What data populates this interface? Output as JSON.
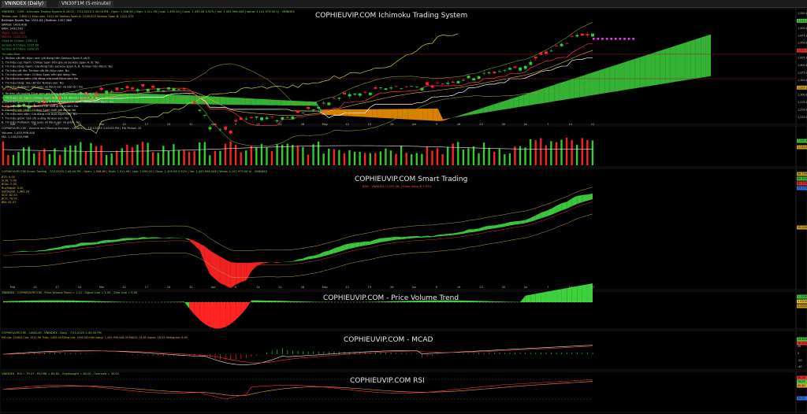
{
  "tabs": [
    {
      "label": "VNINDEX (Daily)",
      "active": true
    },
    {
      "label": "VN30F1M (5-minute)",
      "active": false
    }
  ],
  "watermarks": {
    "price": "COPHIEUVIP.COM Ichimoku Trading System",
    "smart": "COPHIEUVIP.COM Smart Trading",
    "pvt": "COPHIEUVIP.COM - Price Volume Trend",
    "macd": "COPHIEUVIP.COM - MCAD",
    "rsi": "COPHIEUVIP.COM RSI"
  },
  "panel_headers": {
    "price": "VNINDEX - COM - Ichimoku Trading System 6.26.02 - 7/21/2025 2:45:00 PM - Open: 1,508.60 | High: 1,511.96 | Low: 1,495.00 | Close: 1,495.06 0.92% | Vol: 1,455,996,448 | Value: 2,152,979.00 tỷ - VNINDEX",
    "volume": "COPHIEUVIP.COM - Volume and Moving Average - VNINDEX - 7/21/2025 2:45:00 PM | MA Period: 20",
    "smart": "COPHIEUVIP.COM Smart Trading - 7/21/2025 2:45:00 PM - Open: 1,508.60 | High: 1,511.96 | Low: 1,495.00 | Close: 1,495.06 0.92% | Vol: 1,455,996,448 | Value: 2,152,979.00 tỷ - VNINDEX",
    "pvt": "VNINDEX - COPHIEUVIP.COM - Price Volume Trend = 1.12 - Signal Line = 1.05 - Zero Line = 0.00",
    "macd": "COPHIEUVIP.COM - CANSLIM - VNINDEX - Daily - 7/21/2025 2:45:00 PM",
    "rsi": "VNINDEX - RSI = 79.07 - RSI MA = 65.80 - Overbought = 80.00 - Oversold = 30.00"
  },
  "price_info_lines": [
    "Tenkan-sen: 1466.11   Kijun-sen: 1412.00   Senkou Span A: 1239.525   Senkou Span B: 1212.275",
    "Bollinger Bands Top: 1531.63 | Bottom: 1327.288",
    "SMA20: 1420.428",
    "EMA: 1491.592",
    "MA50: 1402.988",
    "MA200: 1283.124",
    "Close At Chikou: 1330.11",
    "Senkou A Chikou: 1235.60",
    "Senkou B Chikou: 1208.35"
  ],
  "signal_lines_bull": [
    "Tín hiệu Mua",
    "1. Tenkan cắt lên Kijun sen: giá đang trên Senkou Span A và B",
    "2. Tín hiệu cực mạnh: Chikou Span trên giá và Senkou Span A, B: Yes",
    "3. Tín hiệu tăng mạnh: Giá đóng trên Senkou Span A, B. Tenkan trên Kijun: Yes",
    "4. Tín hiệu cắt lên: Tenkan cắt lên Kijun-sen: No",
    "5. Tín hiệu xác nhận: Chikou Span trên giá đóng: Yes",
    "6. Tín hiệu mua sớm: Giá đóng cửa vượt Kijun-sen: No",
    "7. Tín hiệu tăng: Giá cắt lên Tenkan-sen: No",
    "8. Tín hiệu Pullback: Giá quay về Kijun-sen và bật lên: No"
  ],
  "signal_lines_bear": [
    "Tín hiệu Bán",
    "1. Tenkan cắt xuống Kijun sen: giá đang dưới Senkou Span A và B",
    "2. Tín hiệu cực mạnh: Chikou Span dưới giá và Senkou Span A, B: No",
    "3. Tín hiệu giảm mạnh: Giá đóng dưới Senkou Span A, B. Tenkan dưới Kijun: No",
    "4. Tín hiệu cắt xuống: Tenkan cắt xuống Kijun-sen: No",
    "5. Tín hiệu xác nhận: Chikou Span dưới giá đóng: No",
    "6. Tín hiệu bán sớm: Giá đóng cửa dưới Kijun-sen: No",
    "7. Tín hiệu giảm: Giá cắt xuống Tenkan-sen: No",
    "8. Tín hiệu Pullback: Giá quay về Kijun-sen và giảm: No"
  ],
  "smart_info_lines": [
    "BTS: 0.00",
    "SCAL: 0.00",
    "BCAL: 0.00",
    "BuySignal: 0.00",
    "SellSignal: 1,463.26",
    "SCO: 82.53",
    "BCO: 79.07",
    "BIN: 81.07"
  ],
  "smart_center_note": "BÁN - VNINDEX (1,495.06) | Điểm dừng lỗ 0.92%",
  "volume_info": [
    "Volume: 1,455,996,448",
    "MA: 1,144,035,966"
  ],
  "macd_info": "Mở cửa: 1508.6   Cao: 1511.96   Thấp: 1495.00   Đóng cửa: 1495.06   Khối lượng: 1,455,996,448.00   MACD: 24.65   Signal: 18.05   Histogram: 6.60",
  "x_axis_labels": [
    "Feb",
    "10",
    "17",
    "24",
    "Mar",
    "10",
    "17",
    "24",
    "31",
    "Apr",
    "9",
    "14",
    "21",
    "28",
    "May",
    "12",
    "19",
    "26",
    "Jun",
    "9",
    "16",
    "23",
    "30",
    "Jul",
    "7",
    "14",
    "21"
  ],
  "price_axis_labels": [
    "1,550.00",
    "1,512.34",
    "1,500.00",
    "1,475.00",
    "1,450.00",
    "1,431.58",
    "1,425.00",
    "1,400.00",
    "1,375.00",
    "1,350.00",
    "1,327.27",
    "1,300.00",
    "1,275.00",
    "1,250.00",
    "1,225.00"
  ],
  "volume_axis_labels": [
    "1,455,996,448",
    "1,144,035,966"
  ],
  "smart_axis_labels": [
    "86.7994",
    "84.3004",
    "82.5294",
    "79.0700",
    "50.0000"
  ],
  "pvt_axis_labels": [
    "1.12000",
    "1.05000",
    "0.00000"
  ],
  "macd_axis_labels": [
    "24.6500",
    "18.0500",
    "20",
    "0",
    "-20",
    "-40"
  ],
  "rsi_axis_labels": [
    "80.00",
    "79.07",
    "65.80",
    "30.00"
  ],
  "colors": {
    "up": "#2bd22b",
    "down": "#ff2323",
    "cloud_bull": "#3dd13d",
    "cloud_bear": "#ff9900",
    "tenkan": "#ff3b3b",
    "kijun": "#ffffff",
    "chikou": "#b6d83a",
    "bollinger": "#7a9c2a",
    "ema": "#e0b030",
    "axis_green": "#3ec43e",
    "axis_red": "#e03030"
  },
  "chart_data": {
    "type": "line",
    "title": "VNINDEX (Daily)",
    "x": [
      "Feb",
      "10",
      "17",
      "24",
      "Mar",
      "10",
      "17",
      "24",
      "31",
      "Apr",
      "9",
      "14",
      "21",
      "28",
      "May",
      "12",
      "19",
      "26",
      "Jun",
      "9",
      "16",
      "23",
      "30",
      "Jul",
      "7",
      "14",
      "21"
    ],
    "series": [
      {
        "name": "Close",
        "values": [
          1265,
          1270,
          1282,
          1300,
          1305,
          1318,
          1325,
          1320,
          1318,
          1230,
          1215,
          1235,
          1225,
          1245,
          1265,
          1300,
          1305,
          1325,
          1325,
          1330,
          1345,
          1360,
          1375,
          1390,
          1430,
          1470,
          1495
        ]
      },
      {
        "name": "Tenkan-sen",
        "values": [
          1262,
          1268,
          1278,
          1292,
          1300,
          1310,
          1318,
          1318,
          1312,
          1270,
          1240,
          1238,
          1234,
          1242,
          1258,
          1285,
          1298,
          1314,
          1320,
          1326,
          1338,
          1352,
          1366,
          1382,
          1412,
          1448,
          1466
        ]
      },
      {
        "name": "Kijun-sen",
        "values": [
          1258,
          1262,
          1270,
          1282,
          1290,
          1298,
          1306,
          1310,
          1308,
          1290,
          1265,
          1250,
          1245,
          1246,
          1252,
          1270,
          1285,
          1298,
          1308,
          1314,
          1322,
          1334,
          1348,
          1360,
          1380,
          1398,
          1412
        ]
      }
    ],
    "ylim": [
      1210,
      1560
    ]
  }
}
